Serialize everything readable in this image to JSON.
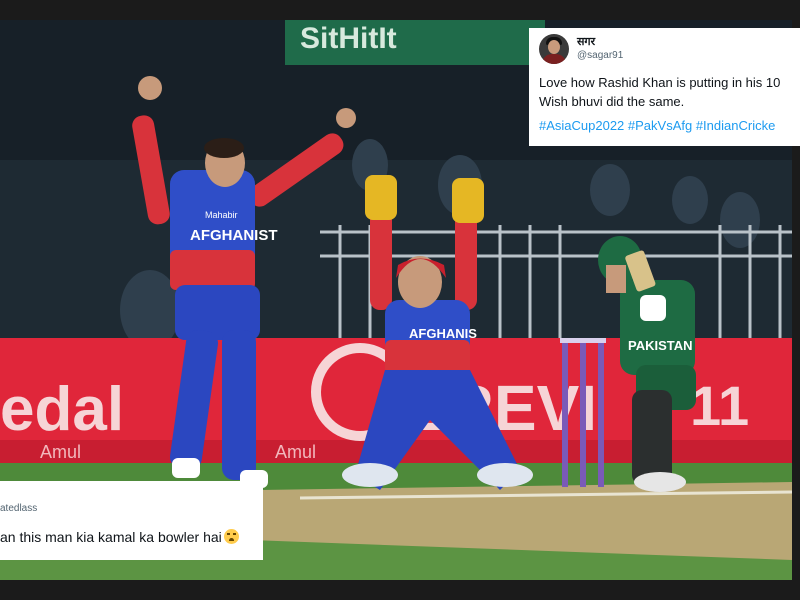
{
  "photo": {
    "description_icon": "cricket-photo",
    "banner_top_text": "SitHitIt",
    "board_left_text": "edal",
    "board_right_text": "EREVI",
    "board_number": "11",
    "amul_text": "Amul",
    "jersey_player1": "AFGHANIST",
    "sponsor_text": "Mahabir",
    "jersey_keeper": "AFGHANIS",
    "jersey_batter": "PAKISTAN",
    "colors": {
      "board_red": "#e0263a",
      "afg_blue": "#2f4ec8",
      "afg_red": "#d8333b",
      "pak_green": "#1e6b43",
      "grass": "#4e8a3a"
    }
  },
  "tweet_top": {
    "name": "सगर",
    "handle": "@sagar91",
    "text_line1": "Love how Rashid Khan is putting in his 10",
    "text_line2": "Wish bhuvi did the same.",
    "hashtags": "#AsiaCup2022 #PakVsAfg #IndianCricke"
  },
  "tweet_bottom": {
    "handle": "atedlass",
    "text": "an this man kia kamal ka bowler hai",
    "emoji": "crying-face"
  }
}
